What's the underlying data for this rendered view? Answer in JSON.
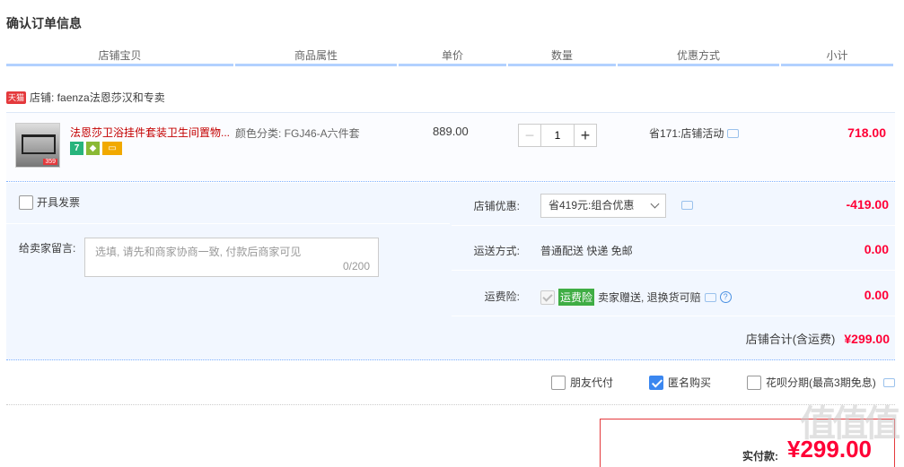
{
  "page": {
    "title": "确认订单信息"
  },
  "columns": [
    "店铺宝贝",
    "商品属性",
    "单价",
    "数量",
    "优惠方式",
    "小计"
  ],
  "shop": {
    "badge": "天猫",
    "label": "店铺: faenza法恩莎汉和专卖"
  },
  "item": {
    "title": "法恩莎卫浴挂件套装卫生间置物...",
    "thumb_tag": "359",
    "icon_seven": "7",
    "attr": "颜色分类: FGJ46-A六件套",
    "price": "889.00",
    "qty_minus": "−",
    "qty_value": "1",
    "qty_plus": "+",
    "promo": "省171:店铺活动",
    "subtotal": "718.00"
  },
  "invoice": {
    "label": "开具发票",
    "checked": false
  },
  "memo": {
    "label": "给卖家留言:",
    "placeholder": "选填, 请先和商家协商一致, 付款后商家可见",
    "count": "0/200"
  },
  "shop_discount": {
    "label": "店铺优惠:",
    "selected": "省419元:组合优惠",
    "value": "-419.00"
  },
  "shipping": {
    "label": "运送方式:",
    "text": "普通配送 快递 免邮",
    "value": "0.00"
  },
  "insurance": {
    "label": "运费险:",
    "badge": "运费险",
    "text": "卖家赠送, 退换货可赔",
    "q": "?",
    "value": "0.00"
  },
  "shop_total": {
    "label": "店铺合计(含运费)",
    "amount": "¥299.00"
  },
  "pay_options": {
    "friend": "朋友代付",
    "anonymous": "匿名购买",
    "huabei": "花呗分期(最高3期免息)"
  },
  "final": {
    "label": "实付款:",
    "amount": "¥299.00"
  },
  "watermark": "值值值",
  "colors": {
    "accent": "#ff0036",
    "header_line": "#b2d1ff",
    "panel_bg": "#f2f7ff",
    "checkbox_blue": "#3b87f0",
    "insurance_green": "#3fad44"
  }
}
